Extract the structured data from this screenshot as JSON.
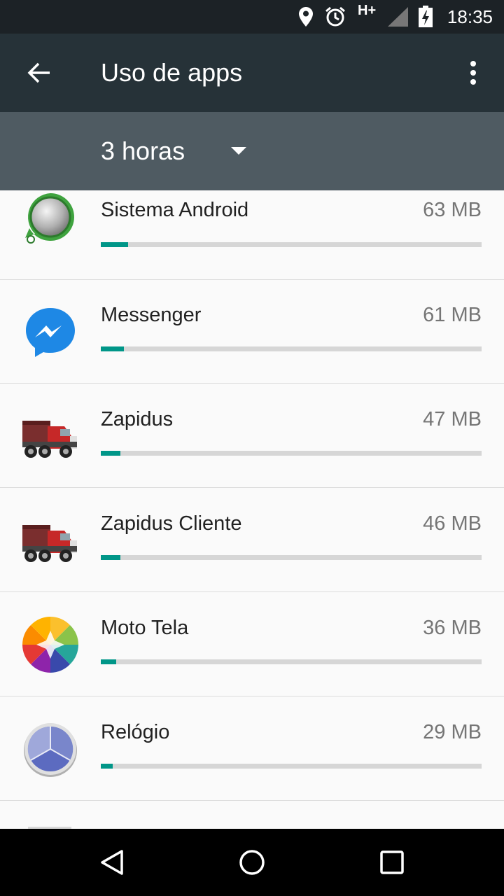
{
  "status_bar": {
    "time": "18:35",
    "network": "H+",
    "icons": [
      "location-icon",
      "alarm-icon",
      "signal-icon",
      "battery-charging-icon"
    ]
  },
  "app_bar": {
    "title": "Uso de apps",
    "back_icon": "arrow-back-icon",
    "menu_icon": "more-vert-icon"
  },
  "spinner": {
    "selected": "3 horas"
  },
  "apps": [
    {
      "name": "Sistema Android",
      "size": "63 MB",
      "usage_fraction": 0.072,
      "icon": "android-system-icon"
    },
    {
      "name": "Messenger",
      "size": "61 MB",
      "usage_fraction": 0.061,
      "icon": "messenger-icon"
    },
    {
      "name": "Zapidus",
      "size": "47 MB",
      "usage_fraction": 0.052,
      "icon": "truck-icon"
    },
    {
      "name": "Zapidus Cliente",
      "size": "46 MB",
      "usage_fraction": 0.052,
      "icon": "truck-icon"
    },
    {
      "name": "Moto Tela",
      "size": "36 MB",
      "usage_fraction": 0.04,
      "icon": "moto-display-icon"
    },
    {
      "name": "Relógio",
      "size": "29 MB",
      "usage_fraction": 0.031,
      "icon": "clock-icon"
    }
  ],
  "colors": {
    "status_bar": "#1c2226",
    "app_bar": "#263238",
    "spinner_bar": "#4f5b62",
    "accent": "#009688",
    "track": "#d6d6d6"
  },
  "nav_bar": {
    "buttons": [
      "back-nav-icon",
      "home-nav-icon",
      "recents-nav-icon"
    ]
  }
}
